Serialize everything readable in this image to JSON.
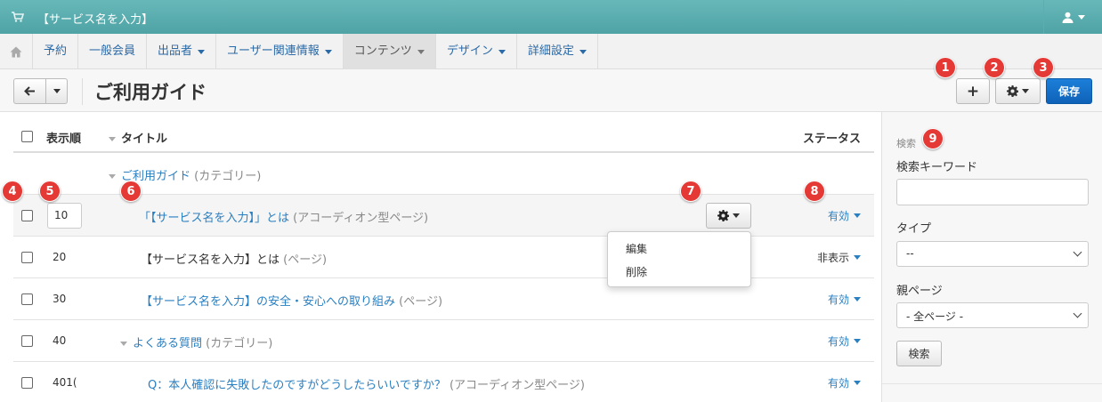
{
  "topbar": {
    "service_name": "【サービス名を入力】",
    "cart_icon": "cart-icon",
    "user_icon": "user-icon"
  },
  "nav": {
    "items": [
      {
        "label": "予約",
        "dropdown": false
      },
      {
        "label": "一般会員",
        "dropdown": false
      },
      {
        "label": "出品者",
        "dropdown": true
      },
      {
        "label": "ユーザー関連情報",
        "dropdown": true
      },
      {
        "label": "コンテンツ",
        "dropdown": true,
        "active": true
      },
      {
        "label": "デザイン",
        "dropdown": true
      },
      {
        "label": "詳細設定",
        "dropdown": true
      }
    ]
  },
  "header": {
    "title": "ご利用ガイド",
    "add_label": "+",
    "save_label": "保存"
  },
  "table": {
    "headers": {
      "order": "表示順",
      "title": "タイトル",
      "status": "ステータス"
    },
    "category_row": {
      "title": "ご利用ガイド",
      "kind": "(カテゴリー)"
    },
    "rows": [
      {
        "order": "10",
        "title": "「【サービス名を入力】」とは",
        "kind": "(アコーディオン型ページ)",
        "status": "有効"
      },
      {
        "order": "20",
        "title": "【サービス名を入力】とは",
        "kind": "(ページ)",
        "status": "非表示"
      },
      {
        "order": "30",
        "title": "【サービス名を入力】の安全・安心への取り組み",
        "kind": "(ページ)",
        "status": "有効"
      },
      {
        "order": "40",
        "title": "よくある質問",
        "kind": "(カテゴリー)",
        "status": "有効"
      },
      {
        "order": "401(",
        "title": "Q：本人確認に失敗したのですがどうしたらいいですか？",
        "kind": "(アコーディオン型ページ)",
        "status": "有効"
      }
    ]
  },
  "row_menu": {
    "edit": "編集",
    "delete": "削除"
  },
  "sidebar": {
    "title": "検索",
    "keyword_label": "検索キーワード",
    "keyword_value": "",
    "type_label": "タイプ",
    "type_value": "--",
    "parent_label": "親ページ",
    "parent_value": "- 全ページ -",
    "search_button": "検索"
  },
  "badges": [
    "1",
    "2",
    "3",
    "4",
    "5",
    "6",
    "7",
    "8",
    "9"
  ],
  "colors": {
    "topbar": "#5aaeb0",
    "link": "#2a7fc1",
    "primary": "#1c7fd9",
    "badge": "#e53935"
  }
}
